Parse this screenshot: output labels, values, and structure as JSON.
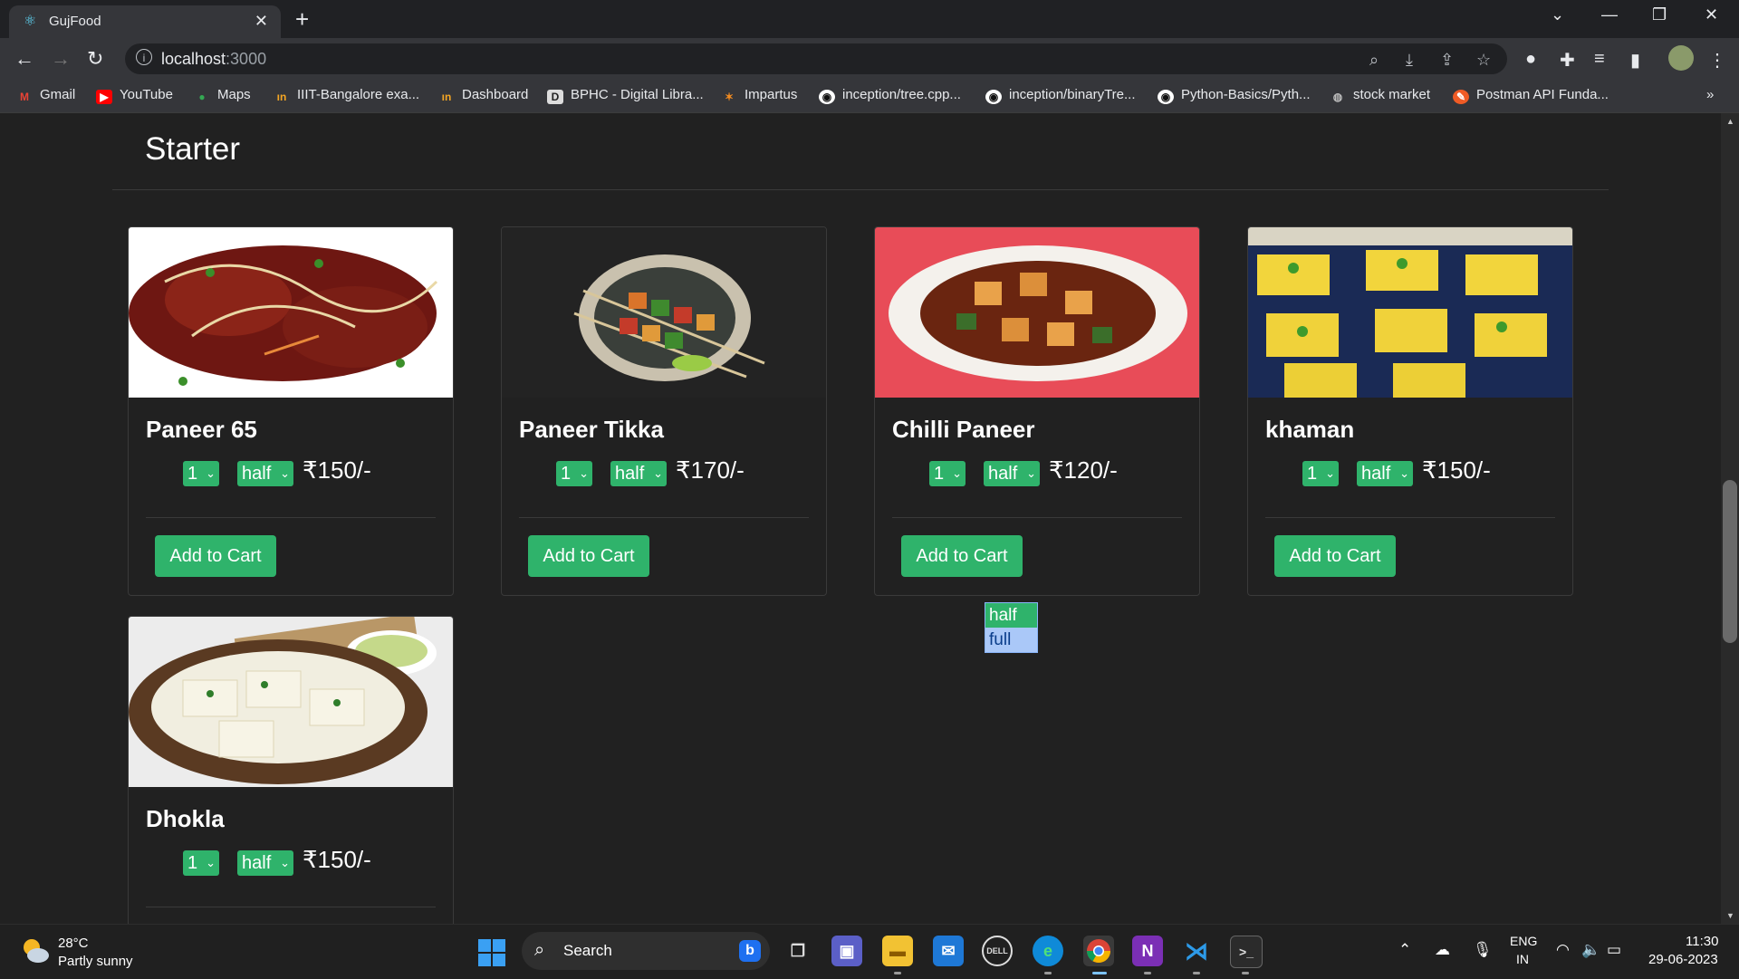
{
  "browser": {
    "tab_title": "GujFood",
    "tab_close": "✕",
    "new_tab": "+",
    "url_host": "localhost",
    "url_port": ":3000",
    "bookmarks": [
      {
        "label": "Gmail",
        "icon": "gmail-icon"
      },
      {
        "label": "YouTube",
        "icon": "youtube-icon"
      },
      {
        "label": "Maps",
        "icon": "maps-icon"
      },
      {
        "label": "IIIT-Bangalore exa...",
        "icon": "iiitb-icon"
      },
      {
        "label": "Dashboard",
        "icon": "dashboard-icon"
      },
      {
        "label": "BPHC - Digital Libra...",
        "icon": "bphc-icon"
      },
      {
        "label": "Impartus",
        "icon": "impartus-icon"
      },
      {
        "label": "inception/tree.cpp...",
        "icon": "github-icon"
      },
      {
        "label": "inception/binaryTre...",
        "icon": "github-icon"
      },
      {
        "label": "Python-Basics/Pyth...",
        "icon": "github-icon"
      },
      {
        "label": "stock market",
        "icon": "globe-icon"
      },
      {
        "label": "Postman API Funda...",
        "icon": "postman-icon"
      }
    ],
    "bookmarks_overflow": "»"
  },
  "page": {
    "section_title": "Starter",
    "add_to_cart_label": "Add to Cart",
    "items": [
      {
        "name": "Paneer 65",
        "qty": "1",
        "size": "half",
        "price": "₹150/-"
      },
      {
        "name": "Paneer Tikka",
        "qty": "1",
        "size": "half",
        "price": "₹170/-"
      },
      {
        "name": "Chilli Paneer",
        "qty": "1",
        "size": "half",
        "price": "₹120/-"
      },
      {
        "name": "khaman",
        "qty": "1",
        "size": "half",
        "price": "₹150/-"
      },
      {
        "name": "Dhokla",
        "qty": "1",
        "size": "half",
        "price": "₹150/-"
      }
    ],
    "size_dropdown_options": [
      "half",
      "full"
    ],
    "size_dropdown_highlighted": "full"
  },
  "taskbar": {
    "weather_temp": "28°C",
    "weather_desc": "Partly sunny",
    "search_label": "Search",
    "lang_line1": "ENG",
    "lang_line2": "IN",
    "time": "11:30",
    "date": "29-06-2023"
  },
  "colors": {
    "accent_green": "#2fb36b",
    "page_bg": "#212121",
    "dropdown_highlight": "#aac8f8"
  }
}
